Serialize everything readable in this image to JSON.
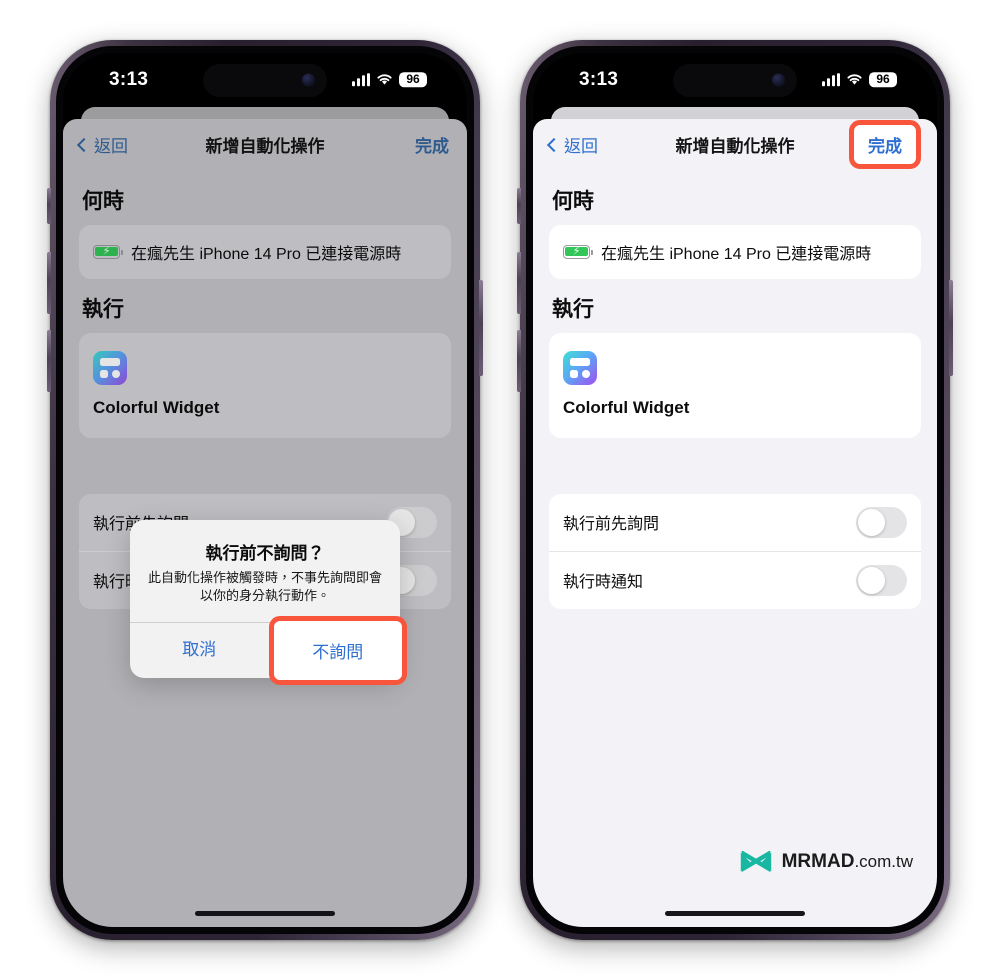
{
  "status_bar": {
    "time": "3:13",
    "battery": "96",
    "signal_icon": "cellular-signal-icon",
    "wifi_icon": "wifi-icon",
    "battery_icon": "battery-icon"
  },
  "nav": {
    "back_label": "返回",
    "title": "新增自動化操作",
    "done_label": "完成"
  },
  "sections": {
    "when_header": "何時",
    "run_header": "執行"
  },
  "trigger": {
    "label": "在瘋先生 iPhone 14 Pro 已連接電源時",
    "icon": "battery-charging-icon"
  },
  "action": {
    "app_name": "Colorful Widget",
    "icon": "colorful-widget-app-icon"
  },
  "toggles": [
    {
      "label": "執行前先詢問",
      "state": "off"
    },
    {
      "label": "執行時通知",
      "state": "off"
    }
  ],
  "alert": {
    "title": "執行前不詢問？",
    "message": "此自動化操作被觸發時，不事先詢問即會以你的身分執行動作。",
    "cancel_label": "取消",
    "confirm_label": "不詢問"
  },
  "watermark": {
    "brand": "MRMAD",
    "suffix": ".com.tw",
    "logo_icon": "mrmad-logo-icon"
  },
  "colors": {
    "highlight": "#f8553c",
    "link_blue": "#2f6fd0",
    "battery_green": "#33c759",
    "logo_teal": "#18b7a2"
  }
}
